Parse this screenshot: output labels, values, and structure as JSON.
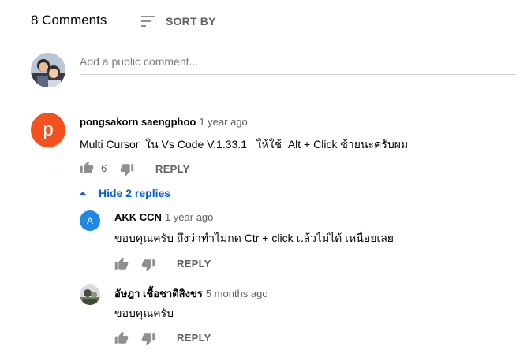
{
  "header": {
    "comment_count": "8 Comments",
    "sort_label": "SORT BY"
  },
  "compose": {
    "placeholder": "Add a public comment..."
  },
  "comments": [
    {
      "avatar_letter": "p",
      "avatar_color": "#f4511e",
      "author": "pongsakorn saengphoo",
      "time": "1 year ago",
      "text": "Multi Cursor  ใน Vs Code V.1.33.1   ให้ใช้  Alt + Click ซ้ายนะครับผม",
      "likes": "6",
      "reply_label": "REPLY",
      "toggle_label": "Hide 2 replies",
      "replies": [
        {
          "avatar_letter": "A",
          "avatar_color": "#1e88e5",
          "author": "AKK CCN",
          "time": "1 year ago",
          "text": "ขอบคุณครับ ถึงว่าทำไมกด Ctr + click แล้วไม่ได้ เหนื่อยเลย",
          "reply_label": "REPLY"
        },
        {
          "author": "อัษฎา เชื้อชาติสิงขร",
          "time": "5 months ago",
          "text": "ขอบคุณครับ",
          "reply_label": "REPLY"
        }
      ]
    }
  ],
  "colors": {
    "accent_blue": "#065fd4",
    "icon_grey": "#909090",
    "secondary_text": "#606060"
  }
}
